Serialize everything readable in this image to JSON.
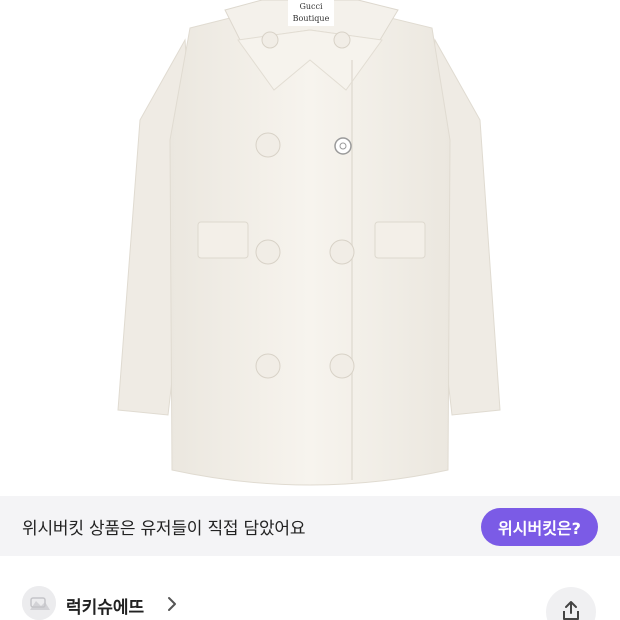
{
  "product": {
    "image_alt_icon": "coat-product-image",
    "label_text_1": "Gucci",
    "label_text_2": "Boutique"
  },
  "wishbucket": {
    "banner_text": "위시버킷 상품은 유저들이 직접 담았어요",
    "button_label": "위시버킷은?",
    "accent_color": "#7b5be6"
  },
  "seller": {
    "name": "럭키슈에뜨",
    "avatar_icon": "seller-avatar-icon",
    "chevron_icon": "chevron-right-icon",
    "share_icon": "share-icon"
  }
}
